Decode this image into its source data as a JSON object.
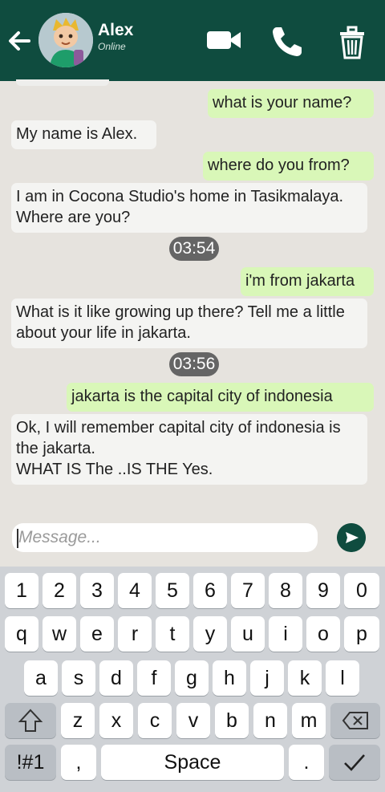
{
  "header": {
    "name": "Alex",
    "status": "Online"
  },
  "messages": [
    {
      "id": "m1",
      "side": "out",
      "text": "what is your name?"
    },
    {
      "id": "m2",
      "side": "in",
      "text": "My name is Alex."
    },
    {
      "id": "m3",
      "side": "out",
      "text": "where do you from?"
    },
    {
      "id": "m4",
      "side": "in",
      "text": "I am in Cocona Studio's home in Tasikmalaya.  Where are you?"
    },
    {
      "id": "t1",
      "side": "time",
      "text": "03:54"
    },
    {
      "id": "m5",
      "side": "out",
      "text": "i'm from jakarta"
    },
    {
      "id": "m6",
      "side": "in",
      "text": "What is it like growing up there?  Tell me a little about your life in jakarta."
    },
    {
      "id": "t2",
      "side": "time",
      "text": "03:56"
    },
    {
      "id": "m7",
      "side": "out",
      "text": "jakarta is the capital city of indonesia"
    },
    {
      "id": "m8",
      "side": "in",
      "text": "Ok, I will remember capital city of indonesia is the jakarta.\nWHAT IS The ..IS  THE Yes."
    }
  ],
  "composer": {
    "placeholder": "Message..."
  },
  "keyboard": {
    "row_numbers": [
      "1",
      "2",
      "3",
      "4",
      "5",
      "6",
      "7",
      "8",
      "9",
      "0"
    ],
    "row_top": [
      "q",
      "w",
      "e",
      "r",
      "t",
      "y",
      "u",
      "i",
      "o",
      "p"
    ],
    "row_mid": [
      "a",
      "s",
      "d",
      "f",
      "g",
      "h",
      "j",
      "k",
      "l"
    ],
    "row_bottom": [
      "z",
      "x",
      "c",
      "v",
      "b",
      "n",
      "m"
    ],
    "symbols_key": "!#1",
    "comma_key": ",",
    "space_key": "Space",
    "period_key": "."
  },
  "colors": {
    "header": "#0f4c3f",
    "outgoing": "#d9f7b8",
    "incoming": "#f4f4f2",
    "background": "#e6e3de"
  }
}
